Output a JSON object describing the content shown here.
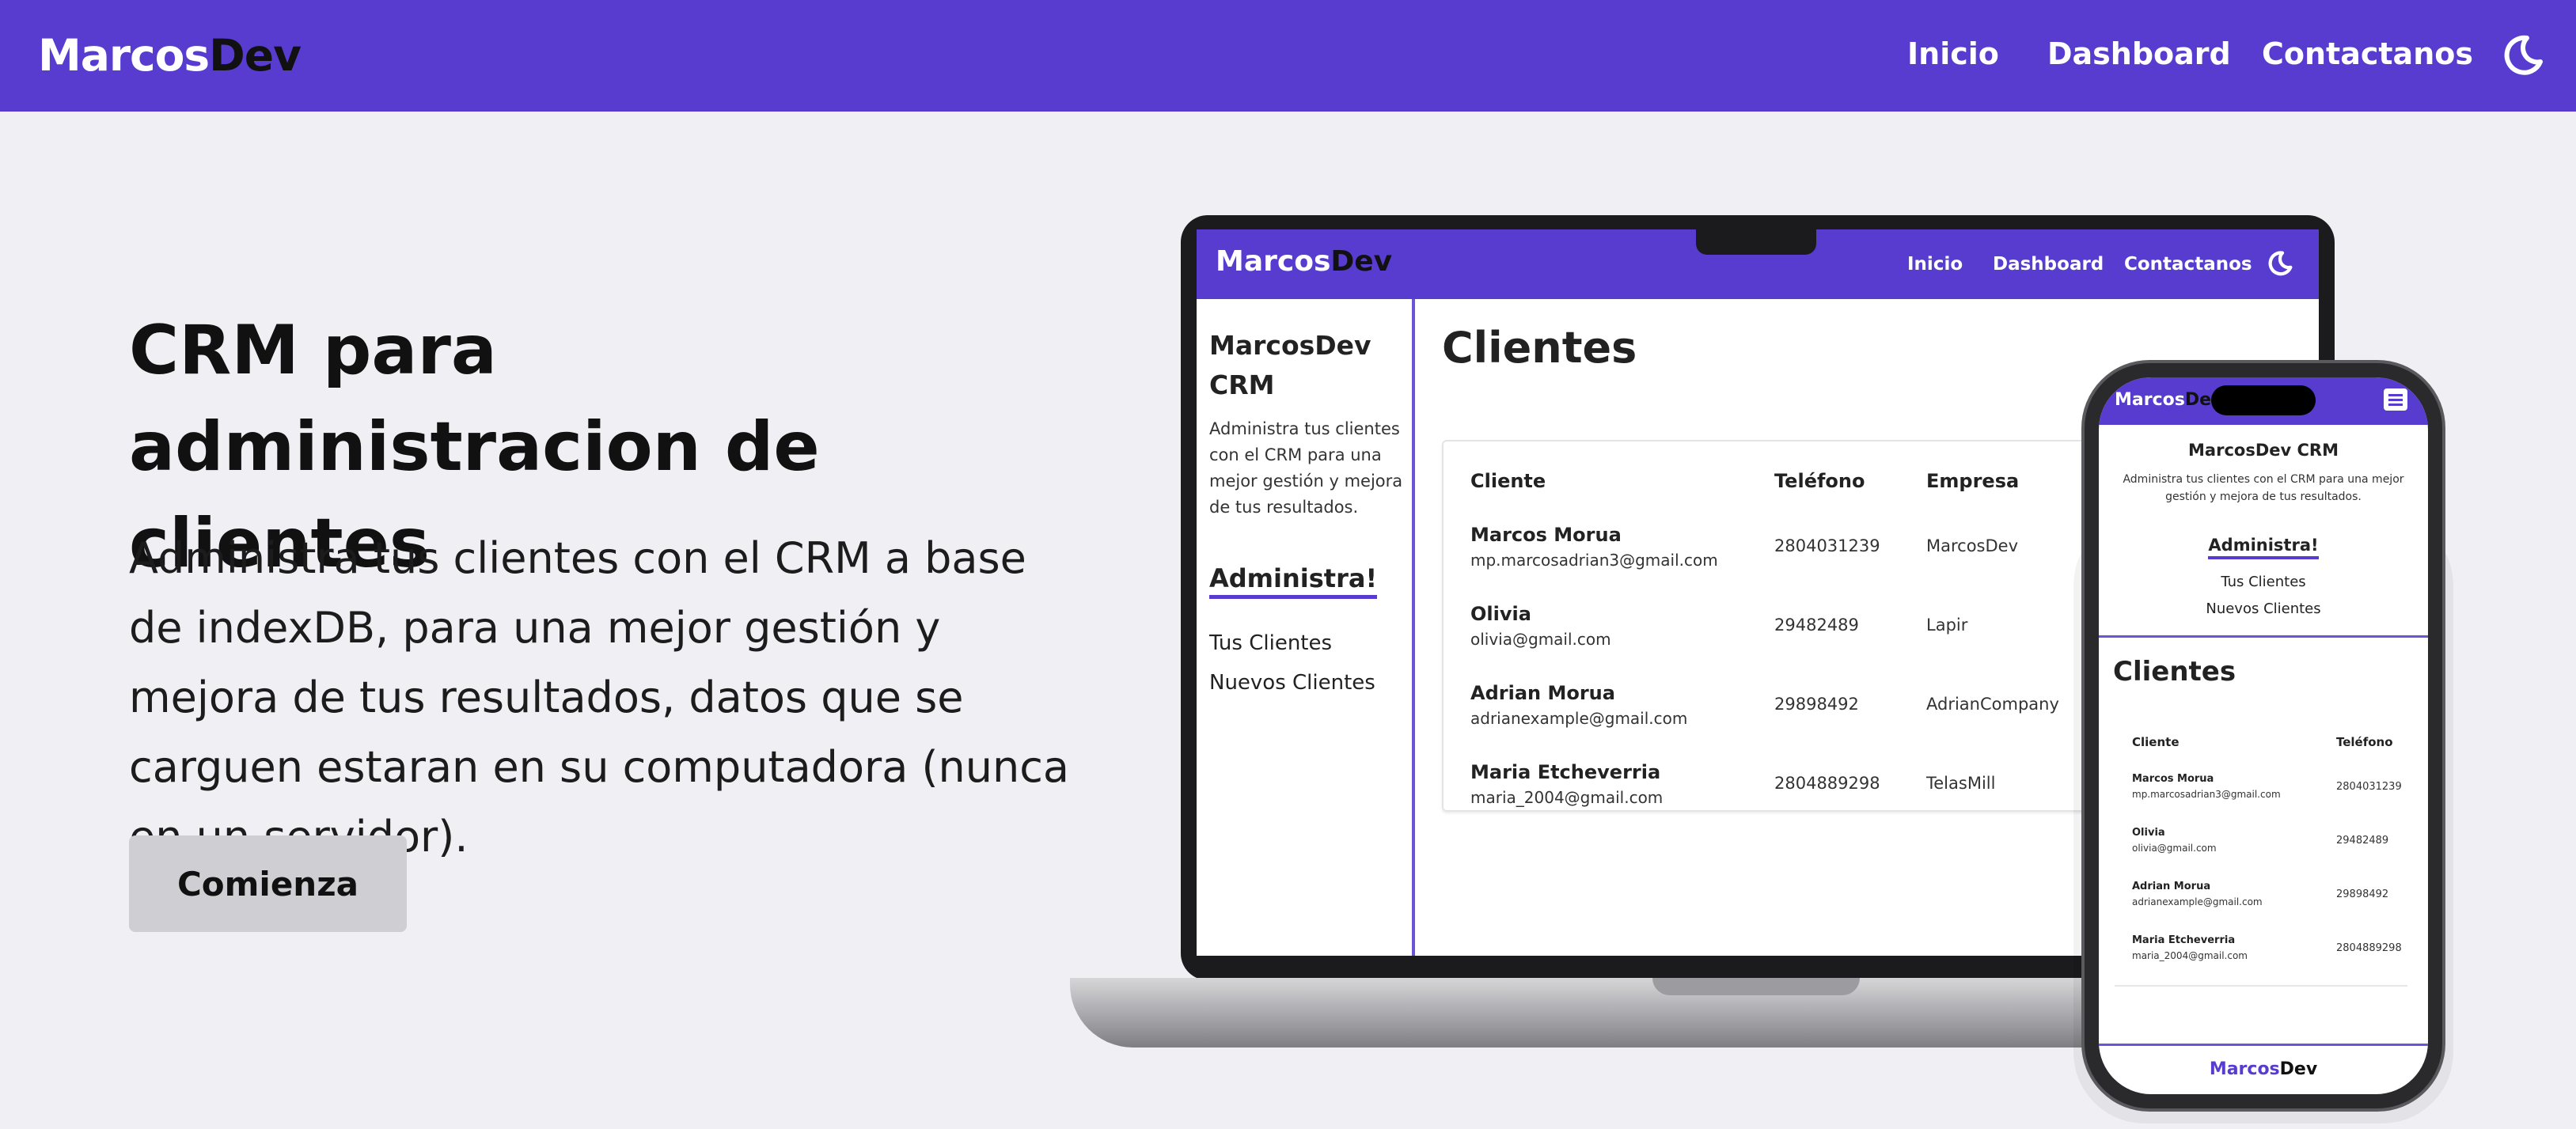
{
  "nav": {
    "brand_part1": "Marcos",
    "brand_part2": "Dev",
    "links": [
      "Inicio",
      "Dashboard",
      "Contactanos"
    ],
    "theme_icon": "moon-icon"
  },
  "hero": {
    "title": "CRM para administracion de clientes",
    "description": "Administra tus clientes con el CRM a base de indexDB, para una mejor gestión y mejora de tus resultados, datos que se carguen estaran en su computadora (nunca en un servidor).",
    "cta_label": "Comienza"
  },
  "laptop_preview": {
    "brand_part1": "Marcos",
    "brand_part2": "Dev",
    "links": [
      "Inicio",
      "Dashboard",
      "Contactanos"
    ],
    "sidebar": {
      "title": "MarcosDev CRM",
      "description": "Administra tus clientes con el CRM para una mejor gestión y mejora de tus resultados.",
      "section": "Administra!",
      "links": [
        "Tus Clientes",
        "Nuevos Clientes"
      ]
    },
    "main_title": "Clientes",
    "table": {
      "headers": [
        "Cliente",
        "Teléfono",
        "Empresa"
      ],
      "rows": [
        {
          "name": "Marcos Morua",
          "email": "mp.marcosadrian3@gmail.com",
          "phone": "2804031239",
          "company": "MarcosDev"
        },
        {
          "name": "Olivia",
          "email": "olivia@gmail.com",
          "phone": "29482489",
          "company": "Lapir"
        },
        {
          "name": "Adrian Morua",
          "email": "adrianexample@gmail.com",
          "phone": "29898492",
          "company": "AdrianCompany"
        },
        {
          "name": "Maria Etcheverria",
          "email": "maria_2004@gmail.com",
          "phone": "2804889298",
          "company": "TelasMill"
        }
      ]
    }
  },
  "phone_preview": {
    "brand_part1": "Marcos",
    "brand_part2": "Dev",
    "menu_icon": "hamburger-menu-icon",
    "title": "MarcosDev CRM",
    "description": "Administra tus clientes con el CRM para una mejor gestión y mejora de tus resultados.",
    "section": "Administra!",
    "links": [
      "Tus Clientes",
      "Nuevos Clientes"
    ],
    "main_title": "Clientes",
    "table": {
      "headers": [
        "Cliente",
        "Teléfono"
      ],
      "rows": [
        {
          "name": "Marcos Morua",
          "email": "mp.marcosadrian3@gmail.com",
          "phone": "2804031239"
        },
        {
          "name": "Olivia",
          "email": "olivia@gmail.com",
          "phone": "29482489"
        },
        {
          "name": "Adrian Morua",
          "email": "adrianexample@gmail.com",
          "phone": "29898492"
        },
        {
          "name": "Maria Etcheverria",
          "email": "maria_2004@gmail.com",
          "phone": "2804889298"
        }
      ]
    },
    "footer_part1": "Marcos",
    "footer_part2": "Dev"
  },
  "colors": {
    "brand_purple": "#573ccf",
    "page_background": "#f0eff4",
    "button_background": "#cfced3"
  }
}
